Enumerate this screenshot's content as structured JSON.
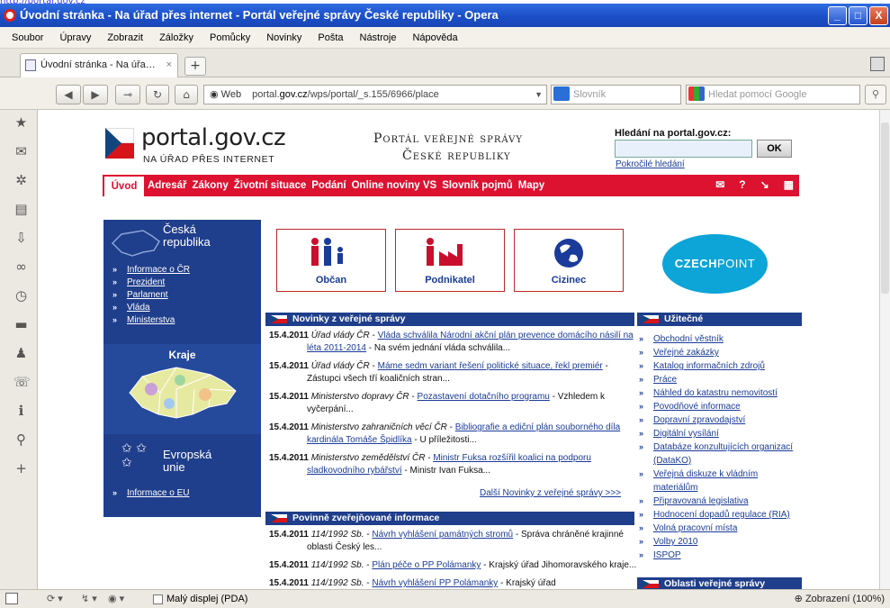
{
  "top_link": "http://portal.gov.cz",
  "window": {
    "title": "Úvodní stránka - Na úřad přes internet - Portál veřejné správy České republiky - Opera",
    "min": "_",
    "max": "□",
    "close": "X"
  },
  "menu": [
    "Soubor",
    "Úpravy",
    "Zobrazit",
    "Záložky",
    "Pomůcky",
    "Novinky",
    "Pošta",
    "Nástroje",
    "Nápověda"
  ],
  "tab": {
    "label": "Úvodní stránka - Na úřa…",
    "close": "×",
    "new": "+"
  },
  "address": {
    "badge": "Web",
    "url_pre": "portal.",
    "url_host": "gov.cz",
    "url_post": "/wps/portal/_s.155/6966/place",
    "dropdown": "▼"
  },
  "search1": {
    "placeholder": "Slovník"
  },
  "search2": {
    "placeholder": "Hledat pomocí Google"
  },
  "statusbar": {
    "pda": "Malý displej (PDA)",
    "zoom": "Zobrazení (100%)"
  },
  "site": {
    "logo_text": "portal.gov.cz",
    "logo_sub": "NA ÚŘAD PŘES INTERNET",
    "portal_line1": "Portál veřejné správy",
    "portal_line2": "České republiky",
    "search_label": "Hledání na portal.gov.cz:",
    "ok": "OK",
    "advanced": "Pokročilé hledání"
  },
  "nav": {
    "active": "Úvod",
    "items": [
      "Adresář",
      "Zákony",
      "Životní situace",
      "Podání",
      "Online noviny VS",
      "Slovník pojmů",
      "Mapy"
    ]
  },
  "left": {
    "czech_title_1": "Česká",
    "czech_title_2": "republika",
    "czech_links": [
      "Informace o ČR",
      "Prezident",
      "Parlament",
      "Vláda",
      "Ministerstva"
    ],
    "kraje": "Kraje",
    "eu_title_1": "Evropská",
    "eu_title_2": "unie",
    "eu_links": [
      "Informace o EU"
    ]
  },
  "tiles": [
    "Občan",
    "Podnikatel",
    "Cizinec"
  ],
  "czechpoint": {
    "a": "CZECH",
    "b": "POINT"
  },
  "news_title": "Novinky z veřejné správy",
  "news": [
    {
      "date": "15.4.2011",
      "source": "Úřad vlády ČR",
      "link": "Vláda schválila Národní akční plán prevence domácího násilí na léta 2011-2014",
      "text": " - Na svém jednání vláda schválila..."
    },
    {
      "date": "15.4.2011",
      "source": "Úřad vlády ČR",
      "link": "Máme sedm variant řešení politické situace, řekl premiér",
      "text": " - Zástupci všech tří koaličních stran..."
    },
    {
      "date": "15.4.2011",
      "source": "Ministerstvo dopravy ČR",
      "link": "Pozastavení dotačního programu",
      "text": " - Vzhledem k vyčerpání..."
    },
    {
      "date": "15.4.2011",
      "source": "Ministerstvo zahraničních věcí ČR",
      "link": "Bibliografie a ediční plán souborného díla kardinála Tomáše Špidlíka",
      "text": " - U příležitosti..."
    },
    {
      "date": "15.4.2011",
      "source": "Ministerstvo zemědělství ČR",
      "link": "Ministr Fuksa rozšířil koalici na podporu sladkovodního rybářství",
      "text": " - Ministr Ivan Fuksa..."
    }
  ],
  "news_more": "Další Novinky z veřejné správy >>>",
  "pov_title": "Povinně zveřejňované informace",
  "pov": [
    {
      "date": "15.4.2011",
      "source": "114/1992 Sb.",
      "link": "Návrh vyhlášení památných stromů",
      "text": " - Správa chráněné krajinné oblasti Český les..."
    },
    {
      "date": "15.4.2011",
      "source": "114/1992 Sb.",
      "link": "Plán péče o PP Polámanky",
      "text": " - Krajský úřad Jihomoravského kraje..."
    },
    {
      "date": "15.4.2011",
      "source": "114/1992 Sb.",
      "link": "Návrh vyhlášení PP Polámanky",
      "text": " - Krajský úřad"
    }
  ],
  "useful_title": "Užitečné",
  "useful": [
    "Obchodní věstník",
    "Veřejné zakázky",
    "Katalog informačních zdrojů",
    "Práce",
    "Náhled do katastru nemovitostí",
    "Povodňové informace",
    "Dopravní zpravodajství",
    "Digitální vysílání",
    "Databáze konzultujících organizací (DataKO)",
    "Veřejná diskuze k vládním materiálům",
    "Připravovaná legislativa",
    "Hodnocení dopadů regulace (RIA)",
    "Volná pracovní místa",
    "Volby 2010",
    "ISPOP"
  ],
  "oblasti_title": "Oblasti veřejné správy"
}
